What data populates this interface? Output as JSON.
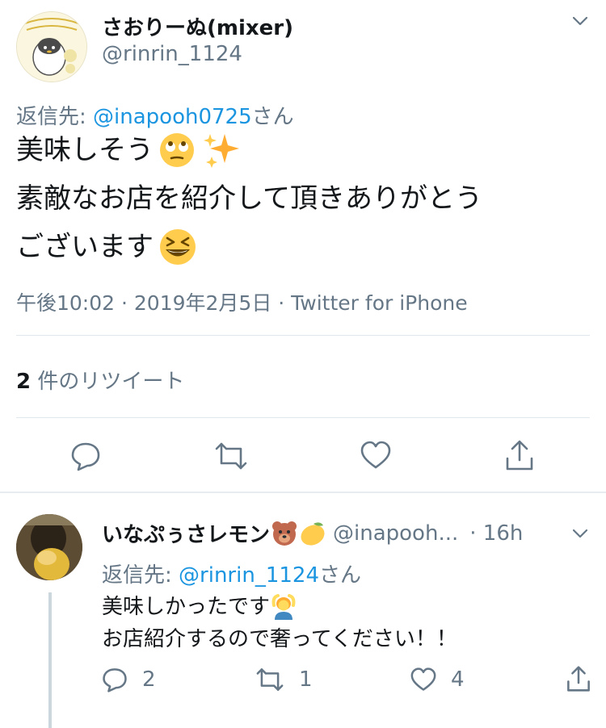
{
  "tweet": {
    "display_name": "さおりーぬ(mixer)",
    "handle": "@rinrin_1124",
    "reply_to_prefix": "返信先: ",
    "reply_to_mention": "@inapooh0725",
    "reply_to_suffix": "さん",
    "line1": "美味しそう",
    "line2": "素敵なお店を紹介して頂きありがとう",
    "line3": "ございます",
    "timestamp": "午後10:02 · 2019年2月5日 · Twitter for iPhone",
    "retweet_count": "2",
    "retweet_label": "件のリツイート",
    "emoji": [
      "rolling-eyes",
      "sparkles",
      "laughing-face"
    ]
  },
  "reply": {
    "display_name": "いなぷぅさレモン",
    "handle": "@inapooh...",
    "time": "· 16h",
    "reply_to_prefix": "返信先: ",
    "reply_to_mention": "@rinrin_1124",
    "reply_to_suffix": "さん",
    "line1": "美味しかったです",
    "line2": "お店紹介するので奢ってください！！",
    "reply_count": "2",
    "retweet_count": "1",
    "like_count": "4",
    "emoji": [
      "bear-face",
      "lemon",
      "person-gesturing-ok"
    ]
  },
  "colors": {
    "accent": "#1b95e0",
    "muted": "#657786",
    "divider": "#e1e8ed"
  }
}
